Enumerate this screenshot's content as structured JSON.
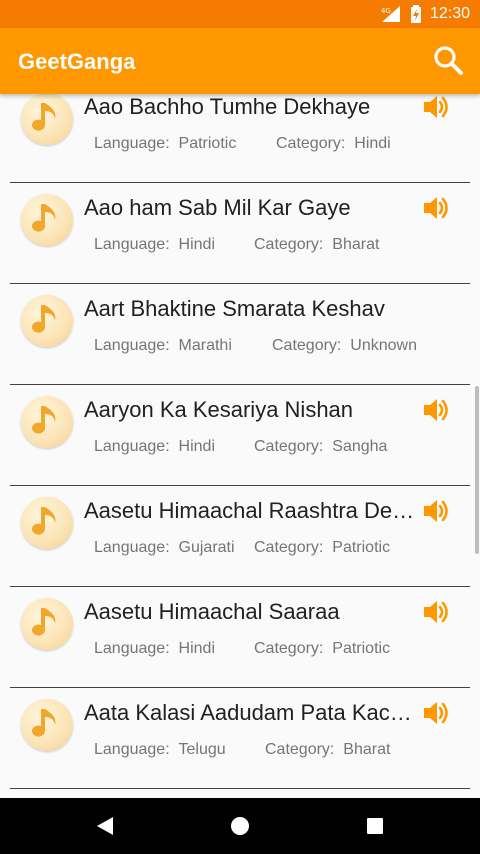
{
  "status_bar": {
    "time": "12:30",
    "network": "4G"
  },
  "app_bar": {
    "title": "GeetGanga",
    "search_icon": "search-icon"
  },
  "labels": {
    "language": "Language:",
    "category": "Category:"
  },
  "colors": {
    "status_bar": "#f57c00",
    "app_bar": "#ff9800",
    "accent": "#ff9800"
  },
  "songs": [
    {
      "title": "Aao Bachho Tumhe Dekhaye",
      "language": "Patriotic",
      "category": "Hindi",
      "audio": true
    },
    {
      "title": "Aao ham Sab Mil Kar Gaye",
      "language": "Hindi",
      "category": "Bharat",
      "audio": true
    },
    {
      "title": "Aart Bhaktine Smarata Keshav",
      "language": "Marathi",
      "category": "Unknown",
      "audio": false
    },
    {
      "title": "Aaryon Ka Kesariya Nishan",
      "language": "Hindi",
      "category": "Sangha",
      "audio": true
    },
    {
      "title": "Aasetu Himaachal Raashtra Devo Bhava",
      "language": "Gujarati",
      "category": "Patriotic",
      "audio": true
    },
    {
      "title": "Aasetu Himaachal Saaraa",
      "language": "Hindi",
      "category": "Patriotic",
      "audio": true
    },
    {
      "title": "Aata Kalasi Aadudam Pata Kachheri",
      "language": "Telugu",
      "category": "Bharat",
      "audio": true
    }
  ],
  "nav_bar": {
    "icons": [
      "back-icon",
      "home-icon",
      "recents-icon"
    ]
  }
}
